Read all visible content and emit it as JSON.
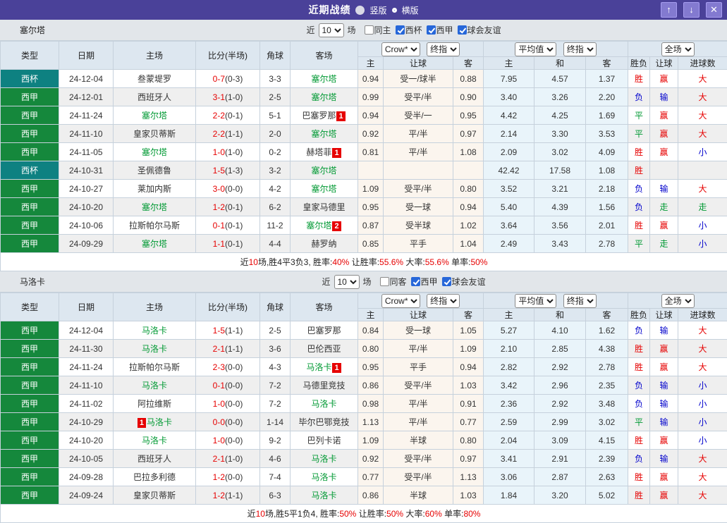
{
  "palette": {
    "titlebar_bg": "#4a4199",
    "accent_button_bg": "#837ad0",
    "accent_button_border": "#a79df0",
    "section_strip_bg": "#e2e6ea",
    "table_header_bg": "#dde7f0",
    "row_alt_bg": "#efefef",
    "odds_col_bg": "#fbf5ee",
    "avg_col_bg": "#e9f4fa",
    "border": "#c6d1dc",
    "red": "#e60000",
    "green": "#009933",
    "blue": "#0000cc",
    "league_colors": {
      "西甲": "#15883c",
      "西杯": "#0e8181"
    },
    "result_color_map": {
      "胜": "red",
      "赢": "red",
      "大": "red",
      "平": "green",
      "走": "green",
      "负": "blue",
      "输": "blue",
      "小": "blue"
    }
  },
  "titlebar": {
    "title": "近期战绩",
    "radios": [
      {
        "label": "竖版",
        "selected": false
      },
      {
        "label": "横版",
        "selected": true
      }
    ],
    "buttons": [
      {
        "name": "move-up",
        "glyph": "↑"
      },
      {
        "name": "move-down",
        "glyph": "↓"
      },
      {
        "name": "close",
        "glyph": "✕"
      }
    ]
  },
  "columns": {
    "type": "类型",
    "date": "日期",
    "home": "主场",
    "score": "比分(半场)",
    "corner": "角球",
    "away": "客场"
  },
  "controls": {
    "dropdown_groups": [
      [
        "Crow*",
        "终指"
      ],
      [
        "平均值",
        "终指"
      ],
      [
        "全场"
      ]
    ],
    "subcols": [
      "主",
      "让球",
      "客",
      "主",
      "和",
      "客",
      "胜负",
      "让球",
      "进球数"
    ]
  },
  "sections": [
    {
      "team": "塞尔塔",
      "filter": {
        "prefix": "近",
        "select_value": "10",
        "suffix": "场",
        "checkboxes": [
          {
            "label": "同主",
            "checked": false
          },
          {
            "label": "西杯",
            "checked": true
          },
          {
            "label": "西甲",
            "checked": true
          },
          {
            "label": "球会友谊",
            "checked": true
          }
        ]
      },
      "rows": [
        {
          "league": "西杯",
          "date": "24-12-04",
          "home": {
            "name": "叁蒙堤罗"
          },
          "score": "0-7",
          "half": "(0-3)",
          "corner": "3-3",
          "away": {
            "name": "塞尔塔",
            "self": true
          },
          "odds": [
            "0.94",
            "受一/球半",
            "0.88"
          ],
          "avg": [
            "7.95",
            "4.57",
            "1.37"
          ],
          "res": [
            "胜",
            "赢",
            "大"
          ]
        },
        {
          "league": "西甲",
          "date": "24-12-01",
          "home": {
            "name": "西班牙人"
          },
          "score": "3-1",
          "half": "(1-0)",
          "corner": "2-5",
          "away": {
            "name": "塞尔塔",
            "self": true
          },
          "odds": [
            "0.99",
            "受平/半",
            "0.90"
          ],
          "avg": [
            "3.40",
            "3.26",
            "2.20"
          ],
          "res": [
            "负",
            "输",
            "大"
          ]
        },
        {
          "league": "西甲",
          "date": "24-11-24",
          "home": {
            "name": "塞尔塔",
            "self": true
          },
          "score": "2-2",
          "half": "(0-1)",
          "corner": "5-1",
          "away": {
            "name": "巴塞罗那",
            "badge": "1",
            "badge_pos": "after"
          },
          "odds": [
            "0.94",
            "受半/一",
            "0.95"
          ],
          "avg": [
            "4.42",
            "4.25",
            "1.69"
          ],
          "res": [
            "平",
            "赢",
            "大"
          ]
        },
        {
          "league": "西甲",
          "date": "24-11-10",
          "home": {
            "name": "皇家贝蒂斯"
          },
          "score": "2-2",
          "half": "(1-1)",
          "corner": "2-0",
          "away": {
            "name": "塞尔塔",
            "self": true
          },
          "odds": [
            "0.92",
            "平/半",
            "0.97"
          ],
          "avg": [
            "2.14",
            "3.30",
            "3.53"
          ],
          "res": [
            "平",
            "赢",
            "大"
          ]
        },
        {
          "league": "西甲",
          "date": "24-11-05",
          "home": {
            "name": "塞尔塔",
            "self": true
          },
          "score": "1-0",
          "half": "(1-0)",
          "corner": "0-2",
          "away": {
            "name": "赫塔菲",
            "badge": "1",
            "badge_pos": "after"
          },
          "odds": [
            "0.81",
            "平/半",
            "1.08"
          ],
          "avg": [
            "2.09",
            "3.02",
            "4.09"
          ],
          "res": [
            "胜",
            "赢",
            "小"
          ]
        },
        {
          "league": "西杯",
          "date": "24-10-31",
          "home": {
            "name": "圣佩德鲁"
          },
          "score": "1-5",
          "half": "(1-3)",
          "corner": "3-2",
          "away": {
            "name": "塞尔塔",
            "self": true
          },
          "odds": [
            "",
            "",
            ""
          ],
          "avg": [
            "42.42",
            "17.58",
            "1.08"
          ],
          "res": [
            "胜",
            "",
            ""
          ]
        },
        {
          "league": "西甲",
          "date": "24-10-27",
          "home": {
            "name": "莱加内斯"
          },
          "score": "3-0",
          "half": "(0-0)",
          "corner": "4-2",
          "away": {
            "name": "塞尔塔",
            "self": true
          },
          "odds": [
            "1.09",
            "受平/半",
            "0.80"
          ],
          "avg": [
            "3.52",
            "3.21",
            "2.18"
          ],
          "res": [
            "负",
            "输",
            "大"
          ]
        },
        {
          "league": "西甲",
          "date": "24-10-20",
          "home": {
            "name": "塞尔塔",
            "self": true
          },
          "score": "1-2",
          "half": "(0-1)",
          "corner": "6-2",
          "away": {
            "name": "皇家马德里"
          },
          "odds": [
            "0.95",
            "受一球",
            "0.94"
          ],
          "avg": [
            "5.40",
            "4.39",
            "1.56"
          ],
          "res": [
            "负",
            "走",
            "走"
          ]
        },
        {
          "league": "西甲",
          "date": "24-10-06",
          "home": {
            "name": "拉斯帕尔马斯"
          },
          "score": "0-1",
          "half": "(0-1)",
          "corner": "11-2",
          "away": {
            "name": "塞尔塔",
            "self": true,
            "badge": "2",
            "badge_pos": "after"
          },
          "odds": [
            "0.87",
            "受半球",
            "1.02"
          ],
          "avg": [
            "3.64",
            "3.56",
            "2.01"
          ],
          "res": [
            "胜",
            "赢",
            "小"
          ]
        },
        {
          "league": "西甲",
          "date": "24-09-29",
          "home": {
            "name": "塞尔塔",
            "self": true
          },
          "score": "1-1",
          "half": "(0-1)",
          "corner": "4-4",
          "away": {
            "name": "赫罗纳"
          },
          "odds": [
            "0.85",
            "平手",
            "1.04"
          ],
          "avg": [
            "2.49",
            "3.43",
            "2.78"
          ],
          "res": [
            "平",
            "走",
            "小"
          ]
        }
      ],
      "summary": [
        {
          "t": "近"
        },
        {
          "t": "10",
          "red": true
        },
        {
          "t": "场,胜4平3负3, 胜率:"
        },
        {
          "t": "40%",
          "red": true
        },
        {
          "t": " 让胜率:"
        },
        {
          "t": "55.6%",
          "red": true
        },
        {
          "t": " 大率:"
        },
        {
          "t": "55.6%",
          "red": true
        },
        {
          "t": " 单率:"
        },
        {
          "t": "50%",
          "red": true
        }
      ]
    },
    {
      "team": "马洛卡",
      "filter": {
        "prefix": "近",
        "select_value": "10",
        "suffix": "场",
        "checkboxes": [
          {
            "label": "同客",
            "checked": false
          },
          {
            "label": "西甲",
            "checked": true
          },
          {
            "label": "球会友谊",
            "checked": true
          }
        ]
      },
      "rows": [
        {
          "league": "西甲",
          "date": "24-12-04",
          "home": {
            "name": "马洛卡",
            "self": true
          },
          "score": "1-5",
          "half": "(1-1)",
          "corner": "2-5",
          "away": {
            "name": "巴塞罗那"
          },
          "odds": [
            "0.84",
            "受一球",
            "1.05"
          ],
          "avg": [
            "5.27",
            "4.10",
            "1.62"
          ],
          "res": [
            "负",
            "输",
            "大"
          ]
        },
        {
          "league": "西甲",
          "date": "24-11-30",
          "home": {
            "name": "马洛卡",
            "self": true
          },
          "score": "2-1",
          "half": "(1-1)",
          "corner": "3-6",
          "away": {
            "name": "巴伦西亚"
          },
          "odds": [
            "0.80",
            "平/半",
            "1.09"
          ],
          "avg": [
            "2.10",
            "2.85",
            "4.38"
          ],
          "res": [
            "胜",
            "赢",
            "大"
          ]
        },
        {
          "league": "西甲",
          "date": "24-11-24",
          "home": {
            "name": "拉斯帕尔马斯"
          },
          "score": "2-3",
          "half": "(0-0)",
          "corner": "4-3",
          "away": {
            "name": "马洛卡",
            "self": true,
            "badge": "1",
            "badge_pos": "after"
          },
          "odds": [
            "0.95",
            "平手",
            "0.94"
          ],
          "avg": [
            "2.82",
            "2.92",
            "2.78"
          ],
          "res": [
            "胜",
            "赢",
            "大"
          ]
        },
        {
          "league": "西甲",
          "date": "24-11-10",
          "home": {
            "name": "马洛卡",
            "self": true
          },
          "score": "0-1",
          "half": "(0-0)",
          "corner": "7-2",
          "away": {
            "name": "马德里竞技"
          },
          "odds": [
            "0.86",
            "受平/半",
            "1.03"
          ],
          "avg": [
            "3.42",
            "2.96",
            "2.35"
          ],
          "res": [
            "负",
            "输",
            "小"
          ]
        },
        {
          "league": "西甲",
          "date": "24-11-02",
          "home": {
            "name": "阿拉维斯"
          },
          "score": "1-0",
          "half": "(0-0)",
          "corner": "7-2",
          "away": {
            "name": "马洛卡",
            "self": true
          },
          "odds": [
            "0.98",
            "平/半",
            "0.91"
          ],
          "avg": [
            "2.36",
            "2.92",
            "3.48"
          ],
          "res": [
            "负",
            "输",
            "小"
          ]
        },
        {
          "league": "西甲",
          "date": "24-10-29",
          "home": {
            "name": "马洛卡",
            "self": true,
            "badge": "1",
            "badge_pos": "before"
          },
          "score": "0-0",
          "half": "(0-0)",
          "corner": "1-14",
          "away": {
            "name": "毕尔巴鄂竞技"
          },
          "odds": [
            "1.13",
            "平/半",
            "0.77"
          ],
          "avg": [
            "2.59",
            "2.99",
            "3.02"
          ],
          "res": [
            "平",
            "输",
            "小"
          ]
        },
        {
          "league": "西甲",
          "date": "24-10-20",
          "home": {
            "name": "马洛卡",
            "self": true
          },
          "score": "1-0",
          "half": "(0-0)",
          "corner": "9-2",
          "away": {
            "name": "巴列卡诺"
          },
          "odds": [
            "1.09",
            "半球",
            "0.80"
          ],
          "avg": [
            "2.04",
            "3.09",
            "4.15"
          ],
          "res": [
            "胜",
            "赢",
            "小"
          ]
        },
        {
          "league": "西甲",
          "date": "24-10-05",
          "home": {
            "name": "西班牙人"
          },
          "score": "2-1",
          "half": "(1-0)",
          "corner": "4-6",
          "away": {
            "name": "马洛卡",
            "self": true
          },
          "odds": [
            "0.92",
            "受平/半",
            "0.97"
          ],
          "avg": [
            "3.41",
            "2.91",
            "2.39"
          ],
          "res": [
            "负",
            "输",
            "大"
          ]
        },
        {
          "league": "西甲",
          "date": "24-09-28",
          "home": {
            "name": "巴拉多利德"
          },
          "score": "1-2",
          "half": "(0-0)",
          "corner": "7-4",
          "away": {
            "name": "马洛卡",
            "self": true
          },
          "odds": [
            "0.77",
            "受平/半",
            "1.13"
          ],
          "avg": [
            "3.06",
            "2.87",
            "2.63"
          ],
          "res": [
            "胜",
            "赢",
            "大"
          ]
        },
        {
          "league": "西甲",
          "date": "24-09-24",
          "home": {
            "name": "皇家贝蒂斯"
          },
          "score": "1-2",
          "half": "(1-1)",
          "corner": "6-3",
          "away": {
            "name": "马洛卡",
            "self": true
          },
          "odds": [
            "0.86",
            "半球",
            "1.03"
          ],
          "avg": [
            "1.84",
            "3.20",
            "5.02"
          ],
          "res": [
            "胜",
            "赢",
            "大"
          ]
        }
      ],
      "summary": [
        {
          "t": "近"
        },
        {
          "t": "10",
          "red": true
        },
        {
          "t": "场,胜5平1负4, 胜率:"
        },
        {
          "t": "50%",
          "red": true
        },
        {
          "t": " 让胜率:"
        },
        {
          "t": "50%",
          "red": true
        },
        {
          "t": " 大率:"
        },
        {
          "t": "60%",
          "red": true
        },
        {
          "t": " 单率:"
        },
        {
          "t": "80%",
          "red": true
        }
      ]
    }
  ]
}
